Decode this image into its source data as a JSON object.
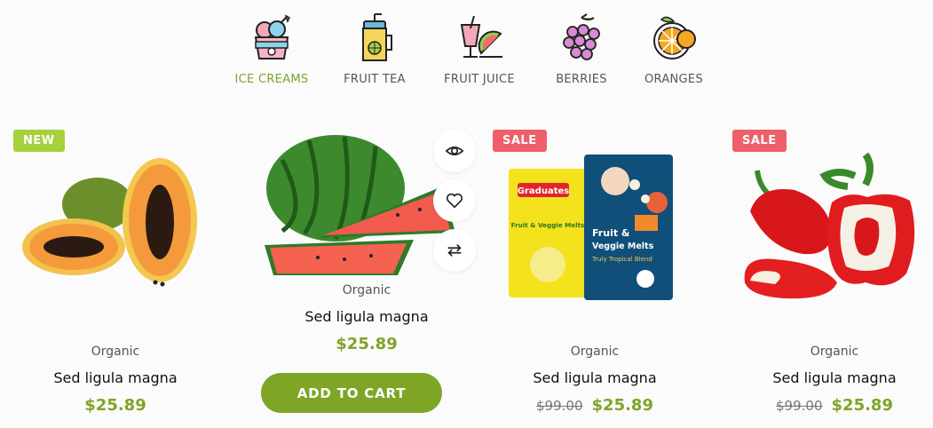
{
  "categories": [
    {
      "label": "ICE CREAMS",
      "icon": "ice-cream-icon",
      "active": true
    },
    {
      "label": "FRUIT TEA",
      "icon": "fruit-tea-icon",
      "active": false
    },
    {
      "label": "FRUIT JUICE",
      "icon": "fruit-juice-icon",
      "active": false
    },
    {
      "label": "BERRIES",
      "icon": "berries-icon",
      "active": false
    },
    {
      "label": "ORANGES",
      "icon": "oranges-icon",
      "active": false
    }
  ],
  "products": [
    {
      "badge": "NEW",
      "image": "papaya",
      "category": "Organic",
      "title": "Sed ligula magna",
      "price": "$25.89",
      "old_price": ""
    },
    {
      "badge": "",
      "image": "watermelon",
      "category": "Organic",
      "title": "Sed ligula magna",
      "price": "$25.89",
      "old_price": "",
      "add_to_cart": "ADD TO CART"
    },
    {
      "badge": "SALE",
      "image": "veggie-melts-packs",
      "category": "Organic",
      "title": "Sed ligula magna",
      "price": "$25.89",
      "old_price": "$99.00"
    },
    {
      "badge": "SALE",
      "image": "red-peppers",
      "category": "Organic",
      "title": "Sed ligula magna",
      "price": "$25.89",
      "old_price": "$99.00"
    }
  ],
  "image_text": {
    "pack1_brand": "Graduates",
    "pack1_line": "Fruit & Veggie Melts",
    "pack2_line1": "Fruit &",
    "pack2_line2": "Veggie Melts",
    "pack2_sub": "Truly Tropical Blend"
  },
  "hover_actions": [
    "eye-icon",
    "heart-icon",
    "compare-icon"
  ],
  "colors": {
    "accent": "#7ea526",
    "new_badge": "#a6d13a",
    "sale_badge": "#ee5f6a"
  }
}
